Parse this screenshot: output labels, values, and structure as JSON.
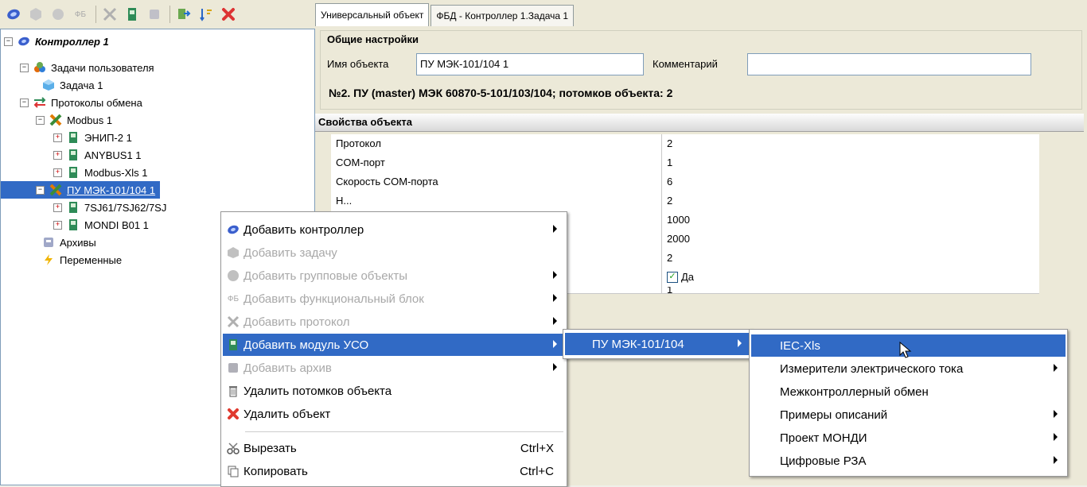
{
  "tree": {
    "root": "Контроллер 1",
    "tasks_group": "Задачи пользователя",
    "task": "Задача 1",
    "protocols_group": "Протоколы обмена",
    "modbus": "Modbus 1",
    "enip": "ЭНИП-2 1",
    "anybus": "ANYBUS1 1",
    "modbus_xls": "Modbus-Xls 1",
    "pu_mek": "ПУ МЭК-101/104 1",
    "sj": "7SJ61/7SJ62/7SJ",
    "mondi": "MONDI B01 1",
    "archives": "Архивы",
    "variables": "Переменные",
    "toolbar_fb": "ФБ"
  },
  "tabs": {
    "universal": "Универсальный объект",
    "fbd": "ФБД - Контроллер 1.Задача 1"
  },
  "general": {
    "title": "Общие настройки",
    "name_label": "Имя объекта",
    "name_value": "ПУ МЭК-101/104 1",
    "comment_label": "Комментарий",
    "comment_value": "",
    "info": "№2. ПУ (master) МЭК 60870-5-101/103/104; потомков объекта: 2"
  },
  "props": {
    "title": "Свойства объекта",
    "rows": [
      {
        "name": "Протокол",
        "value": "2"
      },
      {
        "name": "COM-порт",
        "value": "1"
      },
      {
        "name": "Скорость COM-порта",
        "value": "6"
      },
      {
        "name": "Н...",
        "value": "2"
      },
      {
        "name": "",
        "value": "1000"
      },
      {
        "name": "",
        "value": "2000"
      },
      {
        "name": "",
        "value": "2"
      },
      {
        "name": "",
        "value": "Да"
      },
      {
        "name": "",
        "value": "1"
      }
    ]
  },
  "context_menu": {
    "add_controller": "Добавить контроллер",
    "add_task": "Добавить задачу",
    "add_group": "Добавить групповые объекты",
    "fb_prefix": "ФБ",
    "add_fb": "Добавить функциональный блок",
    "add_protocol": "Добавить протокол",
    "add_uso": "Добавить модуль УСО",
    "add_archive": "Добавить архив",
    "delete_children": "Удалить потомков объекта",
    "delete_object": "Удалить объект",
    "cut": "Вырезать",
    "cut_shortcut": "Ctrl+X",
    "copy": "Копировать",
    "copy_shortcut": "Ctrl+C"
  },
  "submenu1": {
    "pu_mek": "ПУ МЭК-101/104"
  },
  "submenu2": {
    "items": [
      "IEC-Xls",
      "Измерители электрического тока",
      "Межконтроллерный обмен",
      "Примеры описаний",
      "Проект МОНДИ",
      "Цифровые РЗА"
    ]
  },
  "colors": {
    "selection": "#316ac5",
    "panel": "#ece9d8"
  }
}
